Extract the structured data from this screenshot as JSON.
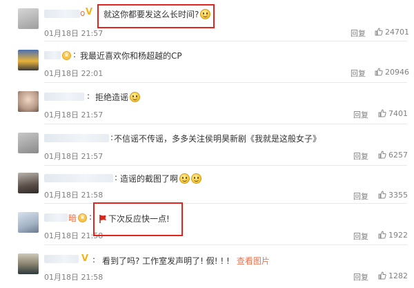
{
  "comments": [
    {
      "nickname": "o",
      "text": "就这你都要发这么长时间?",
      "timestamp": "01月18日 21:57",
      "reply_label": "回复",
      "likes": "24701"
    },
    {
      "nickname": "",
      "text": "我最近喜欢你和杨超越的CP",
      "timestamp": "01月18日 22:01",
      "reply_label": "回复",
      "likes": "20946"
    },
    {
      "nickname": "",
      "text": "拒绝造谣",
      "timestamp": "01月18日 21:57",
      "reply_label": "回复",
      "likes": "7401"
    },
    {
      "nickname": "",
      "text": "不信谣不传谣，多多关注侯明昊新剧《我就是这般女子》",
      "timestamp": "01月18日 21:57",
      "reply_label": "回复",
      "likes": "6257"
    },
    {
      "nickname": "",
      "text": "造谣的截图了啊",
      "timestamp": "01月18日 21:58",
      "reply_label": "回复",
      "likes": "3355"
    },
    {
      "nickname": "暗",
      "text": "下次反应快一点!",
      "timestamp": "01月18日 21:58",
      "reply_label": "回复",
      "likes": "1922"
    },
    {
      "nickname": "",
      "text": "看到了吗? 工作室发声明了! 假! ! !",
      "view_image_label": "查看图片",
      "timestamp": "01月18日 21:58",
      "reply_label": "回复",
      "likes": "1282"
    }
  ],
  "colors": {
    "accent": "#eb7350",
    "highlight_box": "#e4231c",
    "meta": "#808080",
    "link": "#eb7350"
  },
  "icons": {
    "like": "thumbs-up-icon",
    "vip": "vip-crown-icon",
    "verified": "v-badge-icon",
    "emoji": "smile-emoji",
    "flag": "flag-emoji"
  }
}
